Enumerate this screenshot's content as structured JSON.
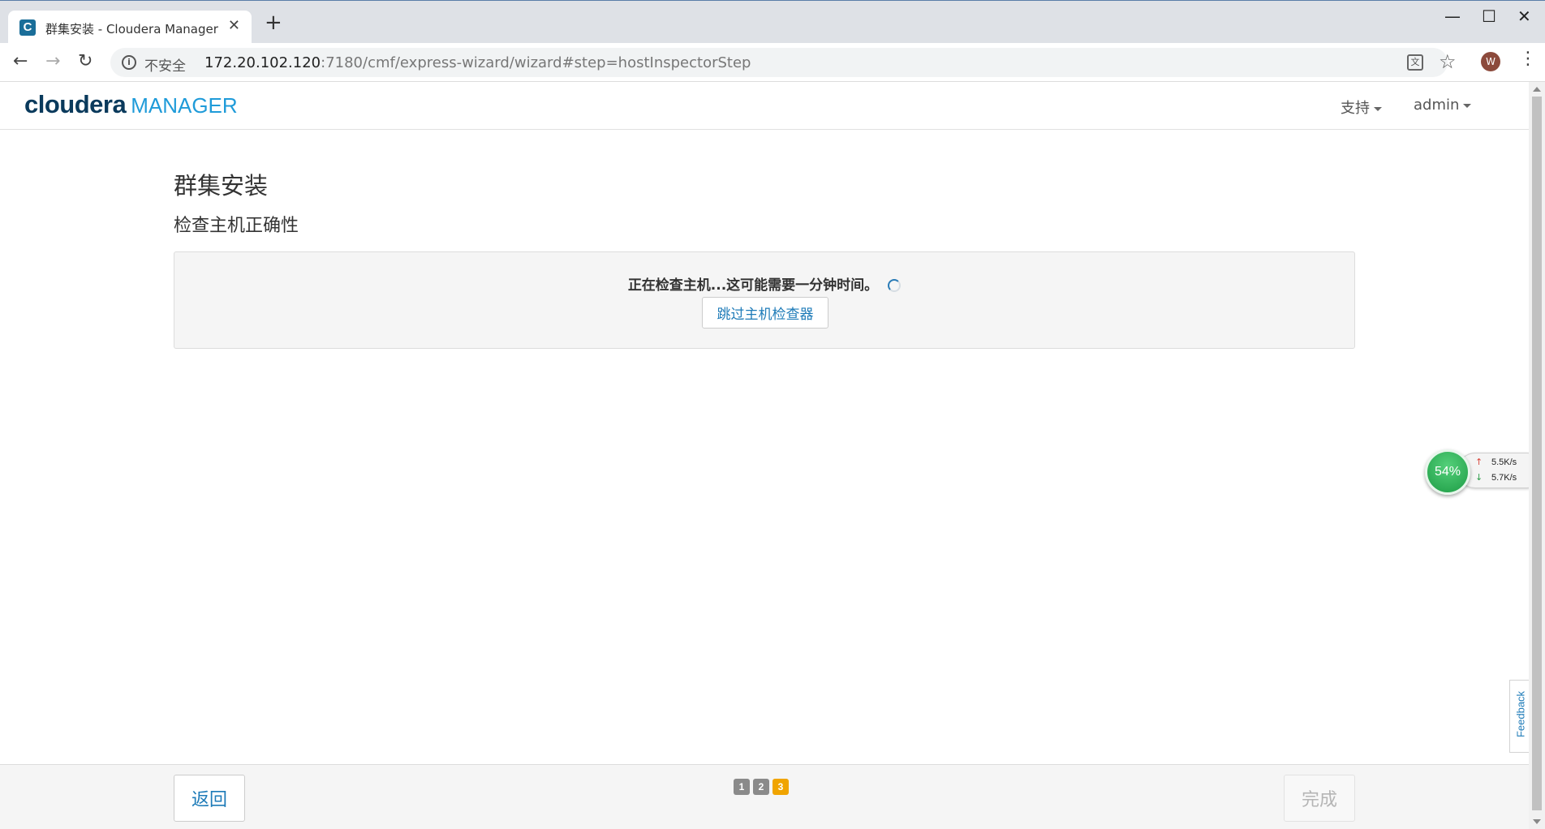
{
  "browser": {
    "tab": {
      "favicon_letter": "C",
      "title": "群集安装 - Cloudera Manager",
      "close": "✕"
    },
    "new_tab": "+",
    "window_controls": {
      "minimize": "—",
      "maximize": "☐",
      "close": "✕"
    },
    "nav": {
      "back": "←",
      "forward": "→",
      "reload": "↻"
    },
    "address": {
      "security_label": "不安全",
      "host": "172.20.102.120",
      "path": ":7180/cmf/express-wizard/wizard#step=hostInspectorStep"
    },
    "icons": {
      "translate": "translate-icon",
      "bookmark": "star-icon",
      "profile": "avatar",
      "menu": "menu-icon"
    },
    "avatar_letter": "W"
  },
  "app": {
    "logo": {
      "brand": "cloudera",
      "product": "MANAGER"
    },
    "nav": {
      "support": "支持",
      "user": "admin"
    }
  },
  "page": {
    "title": "群集安装",
    "subtitle": "检查主机正确性",
    "status": "正在检查主机...这可能需要一分钟时间。",
    "skip_button": "跳过主机检查器"
  },
  "net_widget": {
    "percent": "54%",
    "upload": "5.5K/s",
    "download": "5.7K/s"
  },
  "feedback": "Feedback",
  "footer": {
    "back": "返回",
    "finish": "完成",
    "steps": [
      "1",
      "2",
      "3"
    ],
    "active_step": 3
  },
  "colors": {
    "brand_dark": "#0a3a5c",
    "brand_light": "#1f9bd9",
    "link": "#1e7bb8",
    "active_step": "#f0a400",
    "done_step": "#8a8a8a"
  }
}
